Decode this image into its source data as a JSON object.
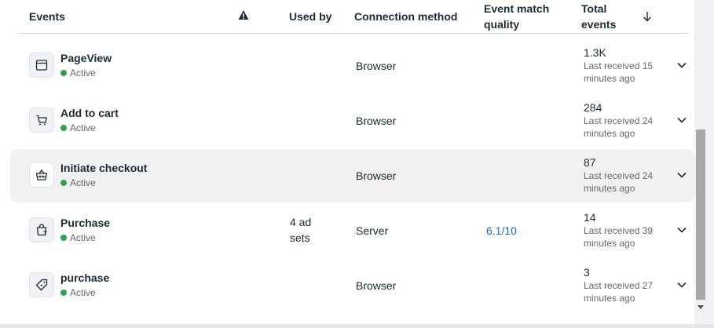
{
  "header": {
    "events": "Events",
    "used_by": "Used by",
    "connection_method": "Connection method",
    "event_match_quality_1": "Event match",
    "event_match_quality_2": "quality",
    "total_events_1": "Total",
    "total_events_2": "events"
  },
  "rows": [
    {
      "name": "PageView",
      "status": "Active",
      "used_by": "",
      "method": "Browser",
      "quality": "",
      "total": "1.3K",
      "last_1": "Last received 15",
      "last_2": "minutes ago",
      "icon": "browser-window-icon"
    },
    {
      "name": "Add to cart",
      "status": "Active",
      "used_by": "",
      "method": "Browser",
      "quality": "",
      "total": "284",
      "last_1": "Last received 24",
      "last_2": "minutes ago",
      "icon": "cart-icon"
    },
    {
      "name": "Initiate checkout",
      "status": "Active",
      "used_by": "",
      "method": "Browser",
      "quality": "",
      "total": "87",
      "last_1": "Last received 24",
      "last_2": "minutes ago",
      "icon": "basket-icon"
    },
    {
      "name": "Purchase",
      "status": "Active",
      "used_by": "4 ad sets",
      "method": "Server",
      "quality": "6.1/10",
      "total": "14",
      "last_1": "Last received 39",
      "last_2": "minutes ago",
      "icon": "shopping-bag-icon"
    },
    {
      "name": "purchase",
      "status": "Active",
      "used_by": "",
      "method": "Browser",
      "quality": "",
      "total": "3",
      "last_1": "Last received 27",
      "last_2": "minutes ago",
      "icon": "price-tag-icon"
    }
  ],
  "colors": {
    "active_dot": "#31a24c",
    "link": "#1a65c9",
    "highlight_row": "#f1f1f1"
  }
}
